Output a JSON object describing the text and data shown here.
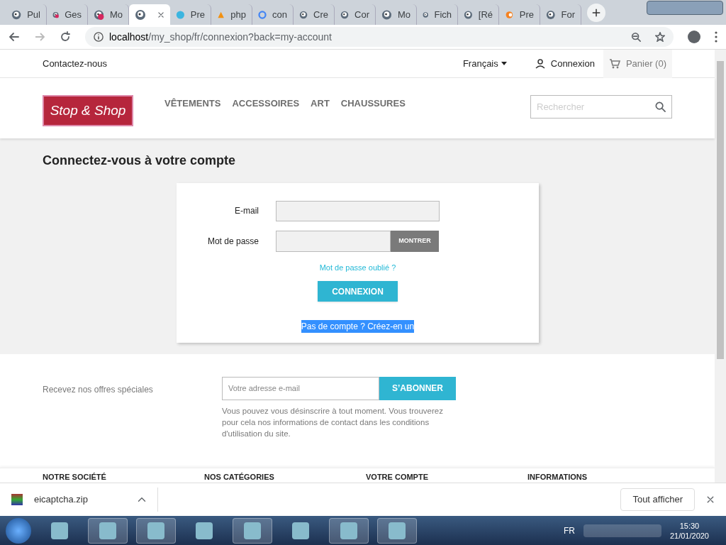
{
  "browser": {
    "tabs": [
      {
        "title": "Pul",
        "selected": false,
        "kind": "shop"
      },
      {
        "title": "Ges",
        "selected": false,
        "kind": "badge"
      },
      {
        "title": "Mo",
        "selected": false,
        "kind": "badge"
      },
      {
        "selected": true,
        "kind": "shop"
      },
      {
        "title": "Pre",
        "selected": false,
        "kind": "globe"
      },
      {
        "title": "php",
        "selected": false,
        "kind": "sail"
      },
      {
        "title": "con",
        "selected": false,
        "kind": "ring"
      },
      {
        "title": "Cre",
        "selected": false,
        "kind": "shop"
      },
      {
        "title": "Cor",
        "selected": false,
        "kind": "shop"
      },
      {
        "title": "Mo",
        "selected": false,
        "kind": "shop"
      },
      {
        "title": "Fich",
        "selected": false,
        "kind": "shop"
      },
      {
        "title": "[Ré",
        "selected": false,
        "kind": "shop"
      },
      {
        "title": "Pre",
        "selected": false,
        "kind": "dot"
      },
      {
        "title": "For",
        "selected": false,
        "kind": "shop"
      }
    ],
    "url_host": "localhost",
    "url_path": "/my_shop/fr/connexion?back=my-account"
  },
  "page": {
    "topbar": {
      "contact": "Contactez-nous",
      "language": "Français",
      "login": "Connexion",
      "cart": "Panier (0)"
    },
    "logo": "Stop & Shop",
    "menu": [
      "VÊTEMENTS",
      "ACCESSOIRES",
      "ART",
      "CHAUSSURES"
    ],
    "search": {
      "placeholder": "Rechercher"
    },
    "heading": "Connectez-vous à votre compte",
    "form": {
      "email_label": "E-mail",
      "password_label": "Mot de passe",
      "show_button": "MONTRER",
      "forgot": "Mot de passe oublié ?",
      "submit": "CONNEXION",
      "no_account": "Pas de compte ? Créez-en un",
      "no_account_highlighted": true
    },
    "newsletter": {
      "label": "Recevez nos offres spéciales",
      "placeholder": "Votre adresse e-mail",
      "button": "S’ABONNER",
      "note": "Vous pouvez vous désinscrire à tout moment. Vous trouverez pour cela nos informations de contact dans les conditions d'utilisation du site."
    },
    "footer_headings": [
      "NOTRE SOCIÉTÉ",
      "NOS CATÉGORIES",
      "VOTRE COMPTE",
      "INFORMATIONS"
    ]
  },
  "downloads": {
    "file": "eicaptcha.zip",
    "show_all": "Tout afficher"
  },
  "taskbar": {
    "language": "FR",
    "time": "15:30",
    "date": "21/01/2020"
  }
}
